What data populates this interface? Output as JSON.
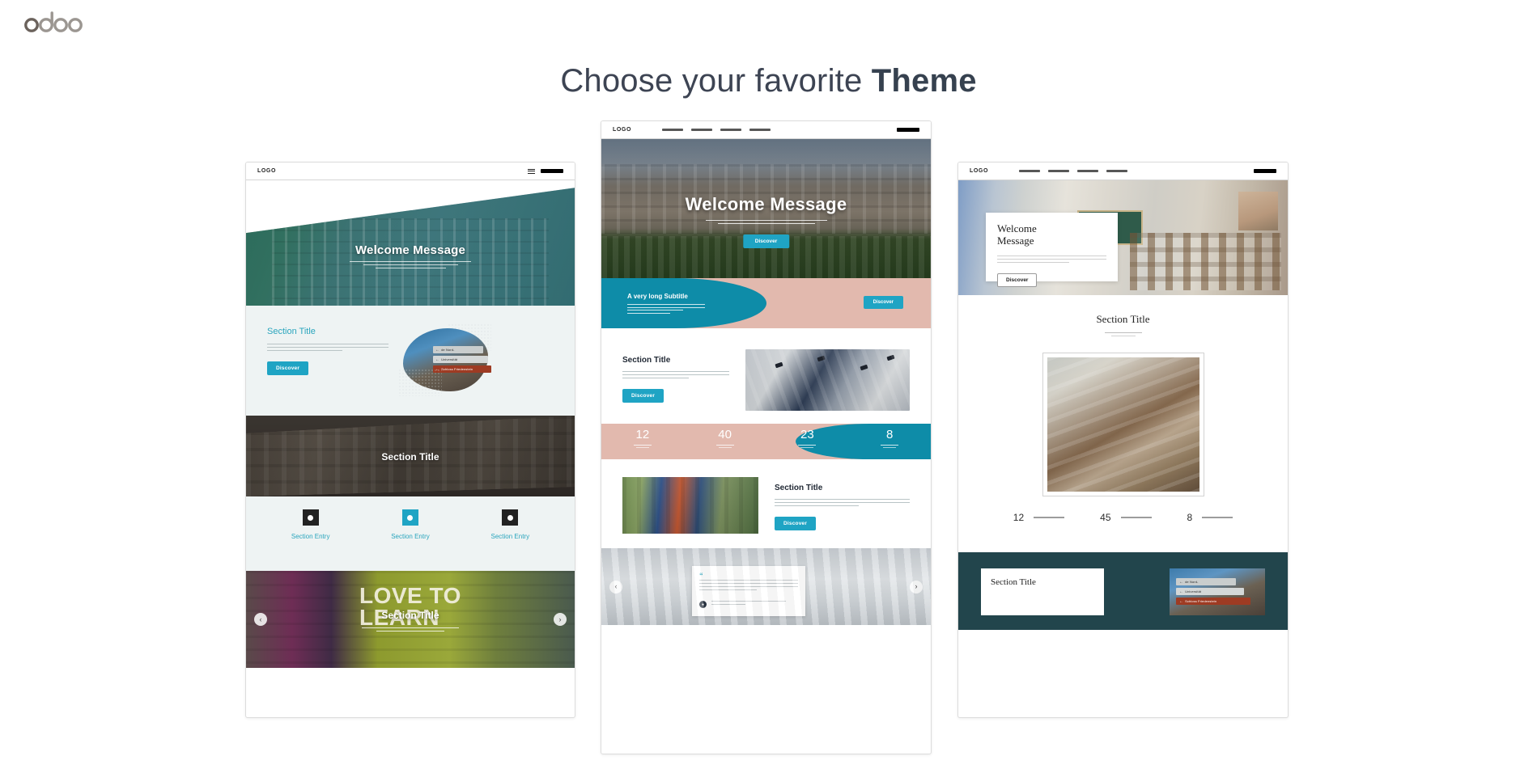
{
  "brand": {
    "logo_text": "odoo",
    "logo_color": "#8f8f8f"
  },
  "header": {
    "title_regular": "Choose your favorite ",
    "title_bold": "Theme"
  },
  "colors": {
    "accent_cyan": "#1fa4c4",
    "accent_teal": "#0e8ca8",
    "accent_pink": "#e2b9ae",
    "heading": "#3d4453",
    "dark_band": "#22454c"
  },
  "themes": [
    {
      "id": "theme-left",
      "nav": {
        "logo": "LOGO",
        "hamburger_icon": "hamburger-icon",
        "cta_placeholder": ""
      },
      "hero": {
        "title": "Welcome Message"
      },
      "section": {
        "title": "Section Title",
        "button": "Discover",
        "signs": [
          {
            "label": "de Nord-",
            "arrow": "←"
          },
          {
            "label": "Universität",
            "arrow": "←"
          },
          {
            "label": "Schloss Friedenstein",
            "arrow": "←"
          }
        ]
      },
      "dark_band": {
        "title": "Section Title"
      },
      "entries": [
        {
          "label": "Section Entry",
          "icon": "circle-dark-icon"
        },
        {
          "label": "Section Entry",
          "icon": "circle-teal-icon"
        },
        {
          "label": "Section Entry",
          "icon": "square-dark-icon"
        }
      ],
      "carousel": {
        "title": "Section Title",
        "poster_line1": "LOVE TO",
        "poster_line2": "LEARN",
        "prev_icon": "chevron-left-icon",
        "next_icon": "chevron-right-icon",
        "prev_glyph": "‹",
        "next_glyph": "›"
      }
    },
    {
      "id": "theme-middle",
      "nav": {
        "logo": "LOGO",
        "links": [
          "",
          "",
          "",
          ""
        ],
        "cta_placeholder": ""
      },
      "hero": {
        "title": "Welcome Message",
        "button": "Discover"
      },
      "subtitle_band": {
        "title": "A very long Subtitle",
        "button": "Discover"
      },
      "section": {
        "title": "Section Title",
        "button": "Discover"
      },
      "counters": [
        {
          "value": "12",
          "tone": "pink"
        },
        {
          "value": "40",
          "tone": "pink"
        },
        {
          "value": "23",
          "tone": "teal"
        },
        {
          "value": "8",
          "tone": "teal"
        }
      ],
      "section2": {
        "title": "Section Title",
        "button": "Discover"
      },
      "testimonial": {
        "quote_mark": "“",
        "avatar_glyph": "●",
        "prev_glyph": "‹",
        "next_glyph": "›"
      }
    },
    {
      "id": "theme-right",
      "nav": {
        "logo": "LOGO",
        "links": [
          "",
          "",
          "",
          ""
        ],
        "cta_placeholder": ""
      },
      "hero_card": {
        "title_line1": "Welcome",
        "title_line2": "Message",
        "button": "Discover"
      },
      "section": {
        "title": "Section Title"
      },
      "stats": [
        {
          "value": "12"
        },
        {
          "value": "45"
        },
        {
          "value": "8"
        }
      ],
      "dark_section": {
        "title": "Section Title",
        "signs": [
          {
            "label": "de Nord-",
            "arrow": "←"
          },
          {
            "label": "Universität",
            "arrow": "←"
          },
          {
            "label": "Schloss Friedenstein",
            "arrow": "←"
          }
        ]
      }
    }
  ]
}
